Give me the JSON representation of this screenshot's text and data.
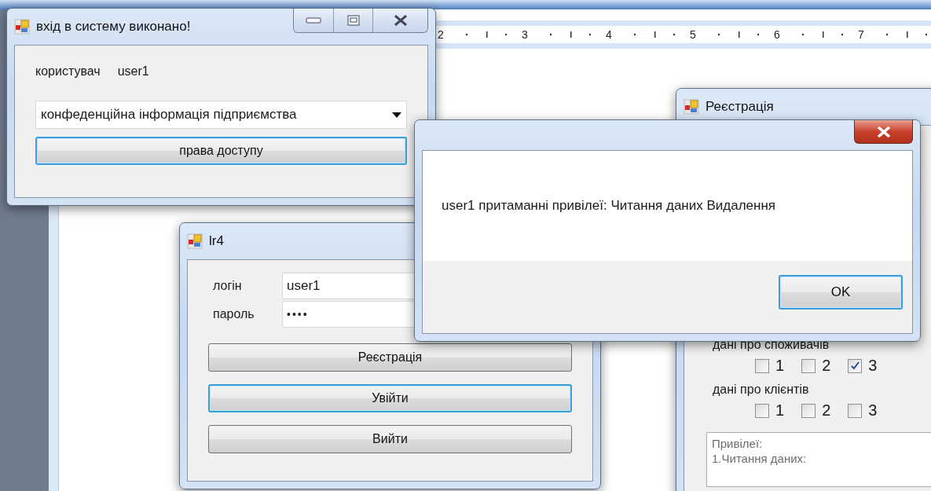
{
  "ruler": {
    "labels": [
      "2",
      "3",
      "4",
      "5",
      "6",
      "7"
    ]
  },
  "result_window": {
    "title": "вхід в систему виконано!",
    "user_label": "користувач",
    "user_value": "user1",
    "dropdown": {
      "value": "конфеденційна інформація підприємства"
    },
    "button": {
      "label": "права доступу",
      "focused": true
    }
  },
  "login_window": {
    "title": "lr4",
    "fields": [
      {
        "kind": "text",
        "label": "логін",
        "value": "user1"
      },
      {
        "kind": "password",
        "label": "пароль",
        "value": "••••"
      }
    ],
    "buttons": [
      {
        "label": "Реєстрація",
        "focused": false
      },
      {
        "label": "Увійти",
        "focused": true
      },
      {
        "label": "Вийти",
        "focused": false
      }
    ]
  },
  "registration_window": {
    "title": "Реєстрація",
    "groups": [
      {
        "label": "дані про споживачів",
        "checkboxes": [
          {
            "label": "1",
            "checked": false
          },
          {
            "label": "2",
            "checked": false
          },
          {
            "label": "3",
            "checked": true
          }
        ]
      },
      {
        "label": "дані про клієнтів",
        "checkboxes": [
          {
            "label": "1",
            "checked": false
          },
          {
            "label": "2",
            "checked": false
          },
          {
            "label": "3",
            "checked": false
          }
        ]
      }
    ],
    "privileges": {
      "lines": [
        "Привілеї:",
        "1.Читання даних:"
      ]
    }
  },
  "message_box": {
    "text": "user1 притаманні привілеї: Читання даних Видалення",
    "button": {
      "label": "OK",
      "focused": true
    }
  }
}
